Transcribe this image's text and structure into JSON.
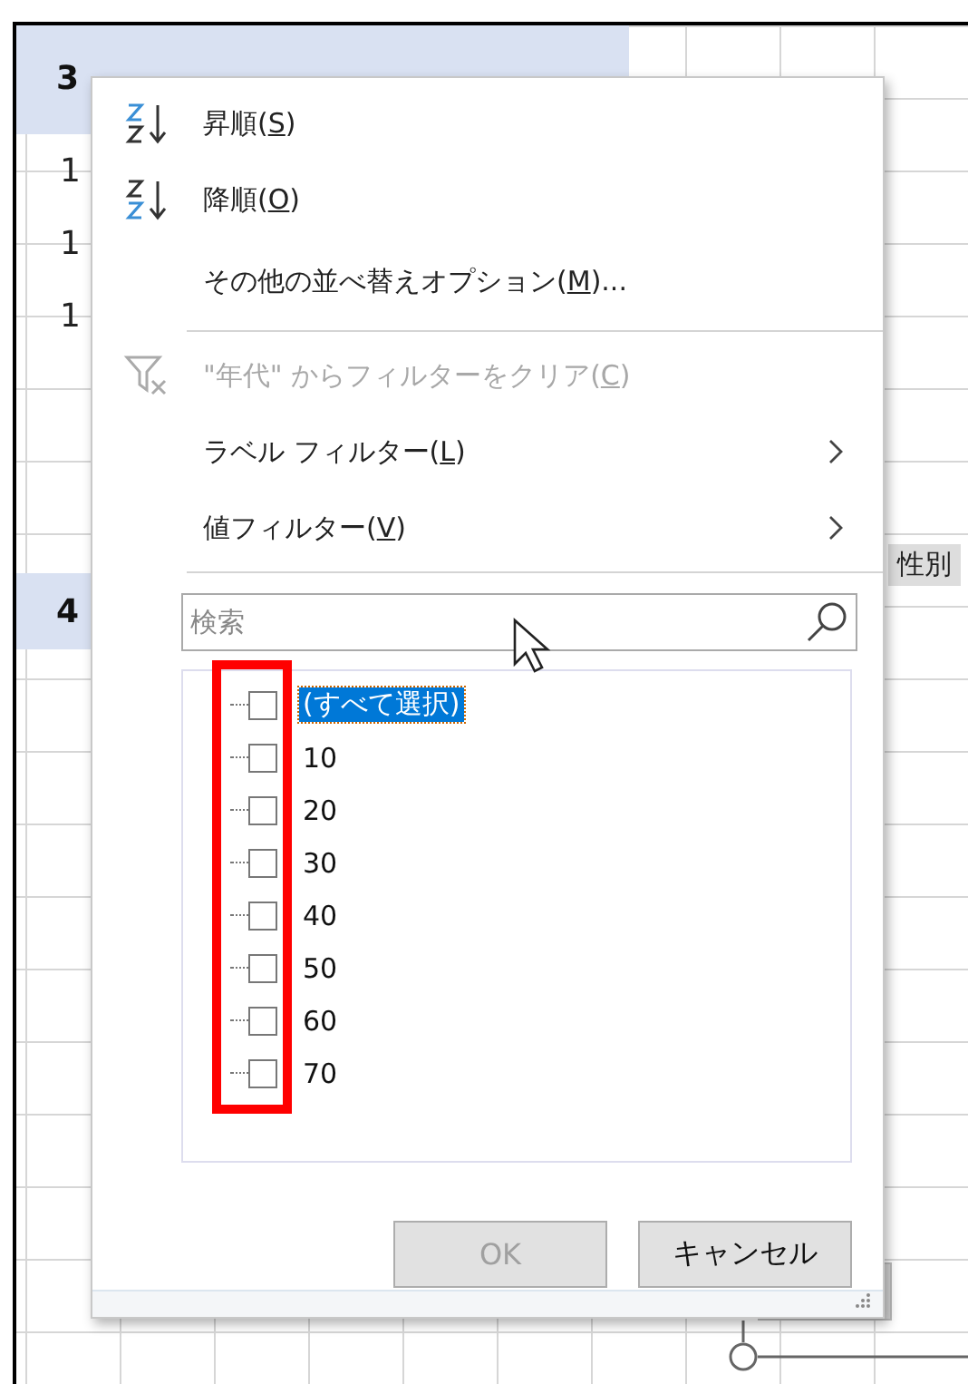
{
  "sheet": {
    "header_band": {
      "text": "3"
    },
    "rows": [
      {
        "text": "1"
      },
      {
        "text": "1"
      },
      {
        "text": "1"
      }
    ],
    "second_band": {
      "text": "4"
    },
    "field_button": {
      "label": "性別"
    }
  },
  "menu": {
    "items": [
      {
        "kind": "sort_asc",
        "disabled": false,
        "submenu": false,
        "parts": [
          {
            "text": "昇順(",
            "underlined": false
          },
          {
            "text": "S",
            "underlined": true
          },
          {
            "text": ")",
            "underlined": false
          }
        ]
      },
      {
        "kind": "sort_desc",
        "disabled": false,
        "submenu": false,
        "parts": [
          {
            "text": "降順(",
            "underlined": false
          },
          {
            "text": "O",
            "underlined": true
          },
          {
            "text": ")",
            "underlined": false
          }
        ]
      },
      {
        "kind": "plain",
        "disabled": false,
        "submenu": false,
        "parts": [
          {
            "text": "その他の並べ替えオプション(",
            "underlined": false
          },
          {
            "text": "M",
            "underlined": true
          },
          {
            "text": ")...",
            "underlined": false
          }
        ]
      },
      {
        "kind": "separator"
      },
      {
        "kind": "clear_filter",
        "disabled": true,
        "submenu": false,
        "parts": [
          {
            "text": "\"年代\" からフィルターをクリア(",
            "underlined": false
          },
          {
            "text": "C",
            "underlined": true
          },
          {
            "text": ")",
            "underlined": false
          }
        ]
      },
      {
        "kind": "plain",
        "disabled": false,
        "submenu": true,
        "parts": [
          {
            "text": "ラベル フィルター(",
            "underlined": false
          },
          {
            "text": "L",
            "underlined": true
          },
          {
            "text": ")",
            "underlined": false
          }
        ]
      },
      {
        "kind": "plain",
        "disabled": false,
        "submenu": true,
        "parts": [
          {
            "text": "値フィルター(",
            "underlined": false
          },
          {
            "text": "V",
            "underlined": true
          },
          {
            "text": ")",
            "underlined": false
          }
        ]
      },
      {
        "kind": "separator"
      }
    ],
    "search": {
      "placeholder": "検索"
    },
    "values": [
      {
        "label": "(すべて選択)",
        "checked": false,
        "selected": true
      },
      {
        "label": "10",
        "checked": false,
        "selected": false
      },
      {
        "label": "20",
        "checked": false,
        "selected": false
      },
      {
        "label": "30",
        "checked": false,
        "selected": false
      },
      {
        "label": "40",
        "checked": false,
        "selected": false
      },
      {
        "label": "50",
        "checked": false,
        "selected": false
      },
      {
        "label": "60",
        "checked": false,
        "selected": false
      },
      {
        "label": "70",
        "checked": false,
        "selected": false
      }
    ],
    "highlight": {
      "shown": true,
      "color": "#ff0000"
    },
    "buttons": [
      {
        "label": "OK",
        "disabled": true
      },
      {
        "label": "キャンセル",
        "disabled": false
      }
    ]
  }
}
